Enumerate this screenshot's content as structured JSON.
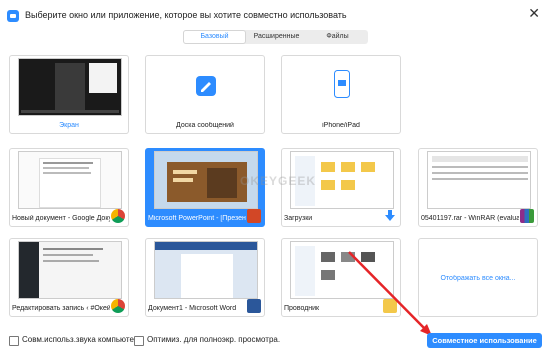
{
  "window": {
    "title": "Выберите окно или приложение, которое вы хотите совместно использовать",
    "close_glyph": "✕"
  },
  "tabs": [
    {
      "label": "Базовый",
      "active": true
    },
    {
      "label": "Расширенные",
      "active": false
    },
    {
      "label": "Файлы",
      "active": false
    }
  ],
  "tiles": [
    {
      "label": "Экран",
      "kind": "screen",
      "selected": false,
      "label_color": "#2d8cff"
    },
    {
      "label": "Доска сообщений",
      "kind": "whiteboard",
      "selected": false
    },
    {
      "label": "iPhone/iPad",
      "kind": "iphone",
      "selected": false
    },
    {
      "label": "",
      "kind": "empty",
      "selected": false
    },
    {
      "label": "Новый документ - Google Доку...",
      "kind": "doc",
      "selected": false,
      "icon": "chrome-icon"
    },
    {
      "label": "Microsoft PowerPoint - [Презент...",
      "kind": "ppt",
      "selected": true,
      "icon": "powerpoint-icon"
    },
    {
      "label": "Загрузки",
      "kind": "folder",
      "selected": false,
      "icon": "download-icon"
    },
    {
      "label": "05401197.rar - WinRAR (evaluatio...",
      "kind": "winrar",
      "selected": false,
      "icon": "winrar-icon"
    },
    {
      "label": "Редактировать запись ‹ #ОкейГ...",
      "kind": "editor",
      "selected": false,
      "icon": "chrome-icon"
    },
    {
      "label": "Документ1 - Microsoft Word",
      "kind": "word",
      "selected": false,
      "icon": "word-icon"
    },
    {
      "label": "Проводник",
      "kind": "explorer",
      "selected": false,
      "icon": "explorer-icon"
    },
    {
      "label": "Отображать все окна...",
      "kind": "show-all",
      "selected": false
    }
  ],
  "watermark": "OKEYGEEK",
  "footer": {
    "computer_sound": "Совм.использ.звука компьютера",
    "optimize": "Оптимиз. для полноэкр. просмотра.",
    "share_button": "Совместное использование"
  },
  "colors": {
    "accent": "#2d8cff",
    "arrow": "#e52528"
  }
}
